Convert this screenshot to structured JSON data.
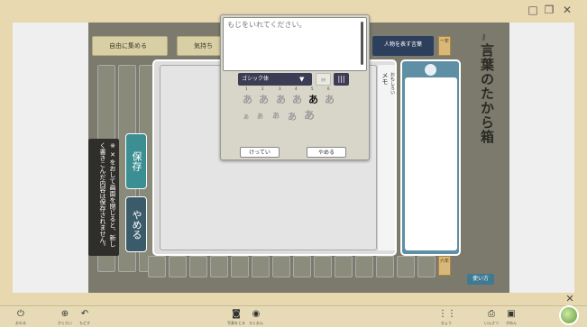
{
  "window": {
    "controls": [
      "□",
      "❐",
      "✕"
    ]
  },
  "board": {
    "tabs": [
      {
        "label": "自由に集める"
      },
      {
        "label": "気持ち"
      },
      {
        "label": "人物を表す言葉"
      }
    ],
    "grade_top": "一年",
    "grade_bottom": "六年"
  },
  "notice": {
    "text": "※ ✕をおして画面を閉じると、新しく書きこんだ内容は保存されません。"
  },
  "actions": {
    "save_label": "保存",
    "cancel_label": "やめる"
  },
  "memo": {
    "label": "メモ",
    "sub_label": "おもしろい"
  },
  "right_panel": {
    "title": "言葉のたから箱",
    "howto_label": "使い方"
  },
  "popup": {
    "placeholder": "もじをいれてください。",
    "font_select": "ゴシック体",
    "size_numbers": [
      "1",
      "2",
      "3",
      "4",
      "5",
      "6"
    ],
    "size_glyphs": [
      "あ",
      "あ",
      "あ",
      "あ",
      "あ",
      "あ"
    ],
    "small_glyphs": [
      "あ",
      "あ",
      "あ",
      "あ",
      "あ"
    ],
    "ok_label": "けってい",
    "cancel_label": "やめる"
  },
  "statusbar": {
    "items": [
      {
        "icon": "power-icon",
        "glyph": "⏻",
        "label": "おわる"
      },
      {
        "icon": "zoom-icon",
        "glyph": "⊕",
        "label": "かくだい"
      },
      {
        "icon": "undo-icon",
        "glyph": "↶",
        "label": "もどす"
      },
      {
        "icon": "camera-icon",
        "glyph": "◙",
        "label": "写真をとる"
      },
      {
        "icon": "record-icon",
        "glyph": "◉",
        "label": "ろくおん"
      },
      {
        "icon": "grid-icon",
        "glyph": "⋮⋮",
        "label": "ひょう"
      },
      {
        "icon": "print-icon",
        "glyph": "⎙",
        "label": "いんさつ"
      },
      {
        "icon": "screen-icon",
        "glyph": "▣",
        "label": "がめん"
      }
    ]
  },
  "colors": {
    "frame": "#e8d8b0",
    "stage": "#7b7a6c",
    "save": "#3b8f93",
    "cancel": "#3a5c6a",
    "card": "#5f8fa5",
    "popup": "#d8d6c8"
  }
}
